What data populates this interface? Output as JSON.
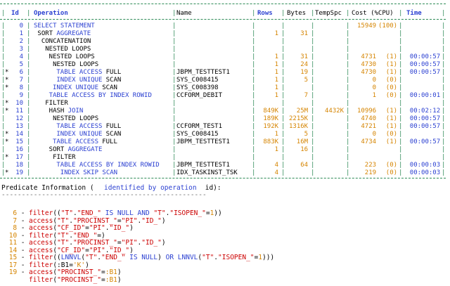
{
  "header": {
    "id": "Id",
    "operation": "Operation",
    "name": "Name",
    "rows": "Rows",
    "bytes": "Bytes",
    "tempspc": "TempSpc",
    "cost": "Cost (%CPU)",
    "time": "Time"
  },
  "plan_rows": [
    {
      "star": "",
      "id": "0",
      "op_prefix": "",
      "op_kw": "SELECT STATEMENT",
      "op_suffix": "",
      "name": "",
      "rows": "",
      "bytes": "",
      "tempspc": "",
      "cost": "15949",
      "cpu": "(100)",
      "time": ""
    },
    {
      "star": "",
      "id": "1",
      "op_prefix": " SORT ",
      "op_kw": "AGGREGATE",
      "op_suffix": "",
      "name": "",
      "rows": "1",
      "bytes": "31",
      "tempspc": "",
      "cost": "",
      "cpu": "",
      "time": ""
    },
    {
      "star": "",
      "id": "2",
      "op_prefix": "  CONCATENATION",
      "op_kw": "",
      "op_suffix": "",
      "name": "",
      "rows": "",
      "bytes": "",
      "tempspc": "",
      "cost": "",
      "cpu": "",
      "time": ""
    },
    {
      "star": "",
      "id": "3",
      "op_prefix": "   NESTED LOOPS",
      "op_kw": "",
      "op_suffix": "",
      "name": "",
      "rows": "",
      "bytes": "",
      "tempspc": "",
      "cost": "",
      "cpu": "",
      "time": ""
    },
    {
      "star": "",
      "id": "4",
      "op_prefix": "    NESTED LOOPS",
      "op_kw": "",
      "op_suffix": "",
      "name": "",
      "rows": "1",
      "bytes": "31",
      "tempspc": "",
      "cost": "4731",
      "cpu": "(1)",
      "time": "00:00:57"
    },
    {
      "star": "",
      "id": "5",
      "op_prefix": "     NESTED LOOPS",
      "op_kw": "",
      "op_suffix": "",
      "name": "",
      "rows": "1",
      "bytes": "24",
      "tempspc": "",
      "cost": "4730",
      "cpu": "(1)",
      "time": "00:00:57"
    },
    {
      "star": "*",
      "id": "6",
      "op_prefix": "      ",
      "op_kw": "TABLE ACCESS",
      "op_suffix": " FULL",
      "name": "JBPM_TESTTEST1",
      "rows": "1",
      "bytes": "19",
      "tempspc": "",
      "cost": "4730",
      "cpu": "(1)",
      "time": "00:00:57"
    },
    {
      "star": "*",
      "id": "7",
      "op_prefix": "      ",
      "op_kw": "INDEX UNIQUE",
      "op_suffix": " SCAN",
      "name": "SYS_C008415",
      "rows": "1",
      "bytes": "5",
      "tempspc": "",
      "cost": "0",
      "cpu": "(0)",
      "time": ""
    },
    {
      "star": "*",
      "id": "8",
      "op_prefix": "     ",
      "op_kw": "INDEX UNIQUE",
      "op_suffix": " SCAN",
      "name": "SYS_C008398",
      "rows": "1",
      "bytes": "",
      "tempspc": "",
      "cost": "0",
      "cpu": "(0)",
      "time": ""
    },
    {
      "star": "",
      "id": "9",
      "op_prefix": "    ",
      "op_kw": "TABLE ACCESS BY INDEX ROWID",
      "op_suffix": "",
      "name": "CCFORM_DEBIT",
      "rows": "1",
      "bytes": "7",
      "tempspc": "",
      "cost": "1",
      "cpu": "(0)",
      "time": "00:00:01"
    },
    {
      "star": "*",
      "id": "10",
      "op_prefix": "   FILTER",
      "op_kw": "",
      "op_suffix": "",
      "name": "",
      "rows": "",
      "bytes": "",
      "tempspc": "",
      "cost": "",
      "cpu": "",
      "time": ""
    },
    {
      "star": "*",
      "id": "11",
      "op_prefix": "    HASH ",
      "op_kw": "JOIN",
      "op_suffix": "",
      "name": "",
      "rows": "849K",
      "bytes": "25M",
      "tempspc": "4432K",
      "cost": "10996",
      "cpu": "(1)",
      "time": "00:02:12"
    },
    {
      "star": "",
      "id": "12",
      "op_prefix": "     NESTED LOOPS",
      "op_kw": "",
      "op_suffix": "",
      "name": "",
      "rows": "189K",
      "bytes": "2215K",
      "tempspc": "",
      "cost": "4740",
      "cpu": "(1)",
      "time": "00:00:57"
    },
    {
      "star": "",
      "id": "13",
      "op_prefix": "      ",
      "op_kw": "TABLE ACCESS",
      "op_suffix": " FULL",
      "name": "CCFORM_TEST1",
      "rows": "192K",
      "bytes": "1316K",
      "tempspc": "",
      "cost": "4721",
      "cpu": "(1)",
      "time": "00:00:57"
    },
    {
      "star": "*",
      "id": "14",
      "op_prefix": "      ",
      "op_kw": "INDEX UNIQUE",
      "op_suffix": " SCAN",
      "name": "SYS_C008415",
      "rows": "1",
      "bytes": "5",
      "tempspc": "",
      "cost": "0",
      "cpu": "(0)",
      "time": ""
    },
    {
      "star": "*",
      "id": "15",
      "op_prefix": "     ",
      "op_kw": "TABLE ACCESS",
      "op_suffix": " FULL",
      "name": "JBPM_TESTTEST1",
      "rows": "883K",
      "bytes": "16M",
      "tempspc": "",
      "cost": "4734",
      "cpu": "(1)",
      "time": "00:00:57"
    },
    {
      "star": "",
      "id": "16",
      "op_prefix": "    SORT ",
      "op_kw": "AGGREGATE",
      "op_suffix": "",
      "name": "",
      "rows": "1",
      "bytes": "16",
      "tempspc": "",
      "cost": "",
      "cpu": "",
      "time": ""
    },
    {
      "star": "*",
      "id": "17",
      "op_prefix": "     FILTER",
      "op_kw": "",
      "op_suffix": "",
      "name": "",
      "rows": "",
      "bytes": "",
      "tempspc": "",
      "cost": "",
      "cpu": "",
      "time": ""
    },
    {
      "star": "",
      "id": "18",
      "op_prefix": "      ",
      "op_kw": "TABLE ACCESS BY INDEX ROWID",
      "op_suffix": "",
      "name": "JBPM_TESTTEST1",
      "rows": "4",
      "bytes": "64",
      "tempspc": "",
      "cost": "223",
      "cpu": "(0)",
      "time": "00:00:03"
    },
    {
      "star": "*",
      "id": "19",
      "op_prefix": "       ",
      "op_kw": "INDEX SKIP SCAN",
      "op_suffix": "",
      "name": "IDX_TASKINST_TSK",
      "rows": "4",
      "bytes": "",
      "tempspc": "",
      "cost": "219",
      "cpu": "(0)",
      "time": "00:00:03"
    }
  ],
  "predicate": {
    "title_prefix": "Predicate Information (",
    "title_kw": "identified by operation",
    "title_suffix": " id):",
    "underline": "---------------------------------------------------",
    "lines": [
      {
        "num": "6",
        "dash": " - ",
        "text": "filter((\"T\".\"END_\" IS NULL AND \"T\".\"ISOPEN_\"=1))"
      },
      {
        "num": "7",
        "dash": " - ",
        "text": "access(\"T\".\"PROCINST_\"=\"PI\".\"ID_\")"
      },
      {
        "num": "8",
        "dash": " - ",
        "text": "access(\"CF_ID\"=\"PI\".\"ID_\")"
      },
      {
        "num": "10",
        "dash": " - ",
        "text": "filter(\"T\".\"END_\"=)"
      },
      {
        "num": "11",
        "dash": " - ",
        "text": "access(\"T\".\"PROCINST_\"=\"PI\".\"ID_\")"
      },
      {
        "num": "14",
        "dash": " - ",
        "text": "access(\"CF_ID\"=\"PI\".\"ID_\")"
      },
      {
        "num": "15",
        "dash": " - ",
        "text": "filter((LNNVL(\"T\".\"END_\" IS NULL) OR LNNVL(\"T\".\"ISOPEN_\"=1)))"
      },
      {
        "num": "17",
        "dash": " - ",
        "text": "filter(:B1='K')"
      },
      {
        "num": "19",
        "dash": " - ",
        "text": "access(\"PROCINST_\"=:B1)"
      },
      {
        "num": "",
        "dash": "",
        "text": "filter(\"PROCINST_\"=:B1)"
      }
    ]
  },
  "colors": {
    "keyword": "#2a3fd1",
    "number": "#d58400",
    "separator": "#2e8b57",
    "text": "#000000"
  }
}
